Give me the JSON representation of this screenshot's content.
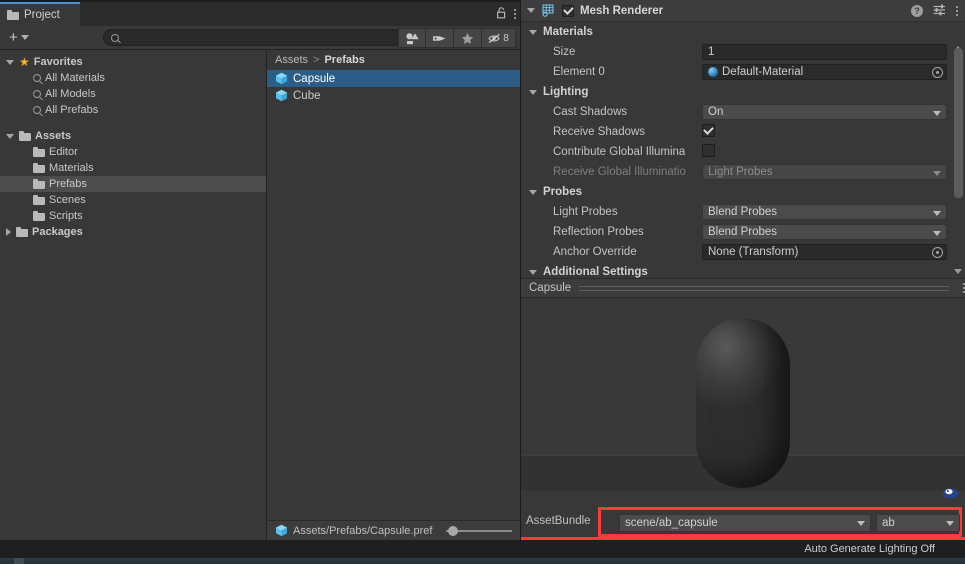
{
  "project_window": {
    "tab": {
      "label": "Project",
      "icon": "folder-icon"
    },
    "lock_icon": "lock-icon",
    "menu_icon": "kebab-menu-icon",
    "toolbar": {
      "add_label": "+",
      "search_value": "",
      "search_placeholder": "",
      "filter_type_icon": "asset-type-filter-icon",
      "filter_label_icon": "label-filter-icon",
      "filter_favorite_icon": "star-filter-icon",
      "hidden_count": "8",
      "hidden_icon": "eye-off-icon"
    },
    "tree": [
      {
        "label": "Favorites",
        "indent": 0,
        "arrow": "down",
        "icon": "star-icon",
        "bold": true,
        "selected": false
      },
      {
        "label": "All Materials",
        "indent": 2,
        "arrow": "none",
        "icon": "search-icon",
        "bold": false,
        "selected": false
      },
      {
        "label": "All Models",
        "indent": 2,
        "arrow": "none",
        "icon": "search-icon",
        "bold": false,
        "selected": false
      },
      {
        "label": "All Prefabs",
        "indent": 2,
        "arrow": "none",
        "icon": "search-icon",
        "bold": false,
        "selected": false
      },
      {
        "label": "",
        "indent": 0,
        "arrow": "none",
        "icon": "none",
        "bold": false,
        "selected": false
      },
      {
        "label": "Assets",
        "indent": 0,
        "arrow": "down",
        "icon": "folder-open-icon",
        "bold": true,
        "selected": false
      },
      {
        "label": "Editor",
        "indent": 2,
        "arrow": "none",
        "icon": "folder-icon",
        "bold": false,
        "selected": false
      },
      {
        "label": "Materials",
        "indent": 2,
        "arrow": "none",
        "icon": "folder-icon",
        "bold": false,
        "selected": false
      },
      {
        "label": "Prefabs",
        "indent": 2,
        "arrow": "none",
        "icon": "folder-icon",
        "bold": false,
        "selected": true
      },
      {
        "label": "Scenes",
        "indent": 2,
        "arrow": "none",
        "icon": "folder-icon",
        "bold": false,
        "selected": false
      },
      {
        "label": "Scripts",
        "indent": 2,
        "arrow": "none",
        "icon": "folder-icon",
        "bold": false,
        "selected": false
      },
      {
        "label": "Packages",
        "indent": 0,
        "arrow": "right",
        "icon": "folder-icon",
        "bold": true,
        "selected": false
      }
    ],
    "breadcrumb": {
      "root": "Assets",
      "separator": ">",
      "current": "Prefabs"
    },
    "items": [
      {
        "label": "Capsule",
        "icon": "prefab-icon",
        "selected": true
      },
      {
        "label": "Cube",
        "icon": "prefab-icon",
        "selected": false
      }
    ],
    "path_bar": {
      "path": "Assets/Prefabs/Capsule.pref",
      "icon": "prefab-icon"
    }
  },
  "inspector": {
    "component": {
      "title": "Mesh Renderer",
      "icon": "mesh-renderer-icon",
      "enabled": true,
      "help_icon": "help-icon",
      "preset_icon": "preset-icon",
      "menu_icon": "kebab-menu-icon"
    },
    "sections": [
      {
        "name": "Materials",
        "rows": [
          {
            "label": "Size",
            "type": "text",
            "value": "1",
            "dim": false
          },
          {
            "label": "Element 0",
            "type": "object",
            "value": "Default-Material",
            "dim": false
          }
        ]
      },
      {
        "name": "Lighting",
        "rows": [
          {
            "label": "Cast Shadows",
            "type": "dropdown",
            "value": "On",
            "dim": false
          },
          {
            "label": "Receive Shadows",
            "type": "checkbox",
            "value": true,
            "dim": false
          },
          {
            "label": "Contribute Global Illumina",
            "type": "checkbox",
            "value": false,
            "dim": false
          },
          {
            "label": "Receive Global Illuminatio",
            "type": "dropdown",
            "value": "Light Probes",
            "dim": true
          }
        ]
      },
      {
        "name": "Probes",
        "rows": [
          {
            "label": "Light Probes",
            "type": "dropdown",
            "value": "Blend Probes",
            "dim": false
          },
          {
            "label": "Reflection Probes",
            "type": "dropdown",
            "value": "Blend Probes",
            "dim": false
          },
          {
            "label": "Anchor Override",
            "type": "object-empty",
            "value": "None (Transform)",
            "dim": false
          }
        ]
      },
      {
        "name": "Additional Settings",
        "rows": []
      }
    ],
    "preview": {
      "title": "Capsule",
      "menu_icon": "kebab-menu-icon",
      "lighting_icon": "preview-lighting-icon"
    },
    "assetbundle": {
      "label": "AssetBundle",
      "name_value": "scene/ab_capsule",
      "variant_value": "ab",
      "highlight_color": "#fb3b3b"
    }
  },
  "status_bar": {
    "message": "Auto Generate Lighting Off"
  }
}
